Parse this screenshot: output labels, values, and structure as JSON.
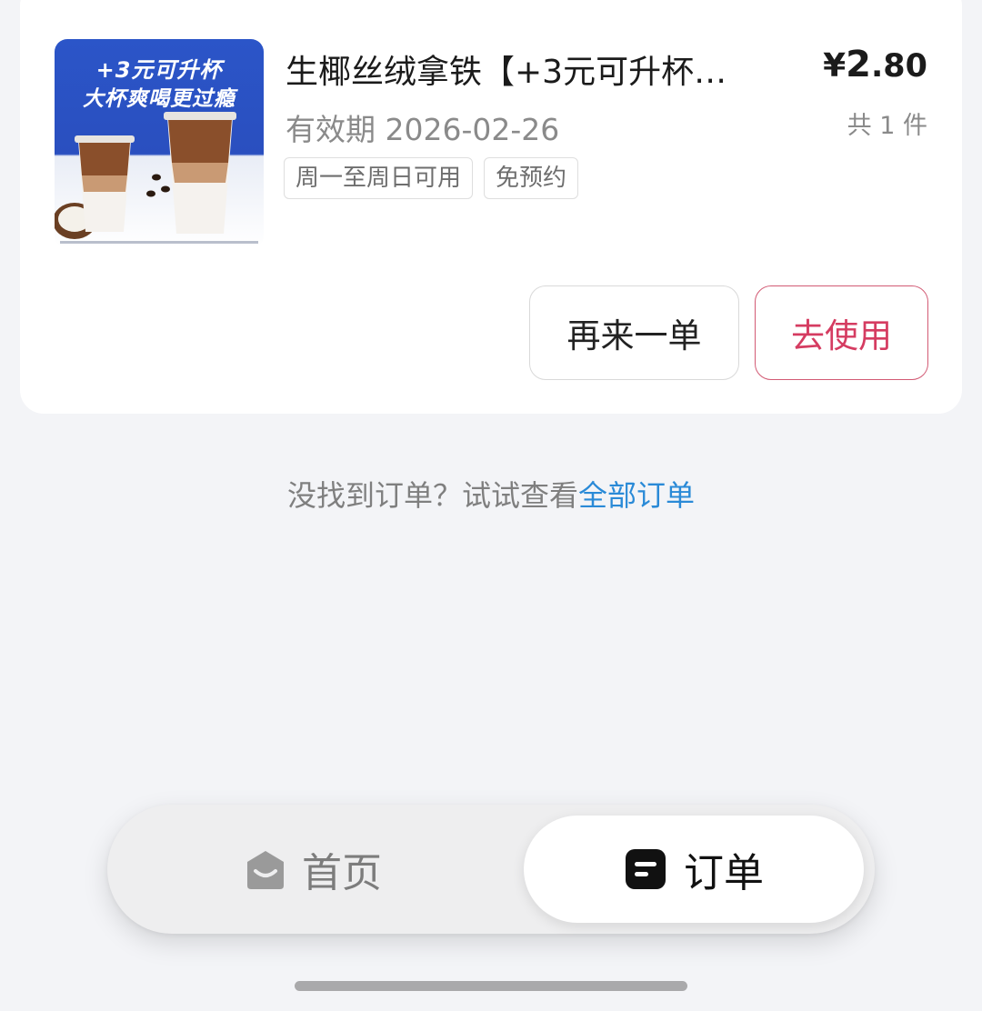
{
  "order": {
    "thumbnail": {
      "line1": "+3元可升杯",
      "line2": "大杯爽喝更过瘾"
    },
    "title": "生椰丝绒拿铁【+3元可升杯…",
    "price_symbol": "¥",
    "price_int": "2",
    "price_dec": ".80",
    "expiry": "有效期 2026-02-26",
    "count": "共 1 件",
    "tags": [
      "周一至周日可用",
      "免预约"
    ],
    "reorder_label": "再来一单",
    "use_label": "去使用"
  },
  "hint": {
    "text": "没找到订单？试试查看",
    "link": "全部订单"
  },
  "tabbar": {
    "home_label": "首页",
    "orders_label": "订单"
  },
  "colors": {
    "accent_red": "#d53c61",
    "link_blue": "#2a8ad7",
    "thumb_blue": "#2b55c8"
  },
  "icons": {
    "home": "home-envelope-icon",
    "orders": "order-list-icon"
  }
}
